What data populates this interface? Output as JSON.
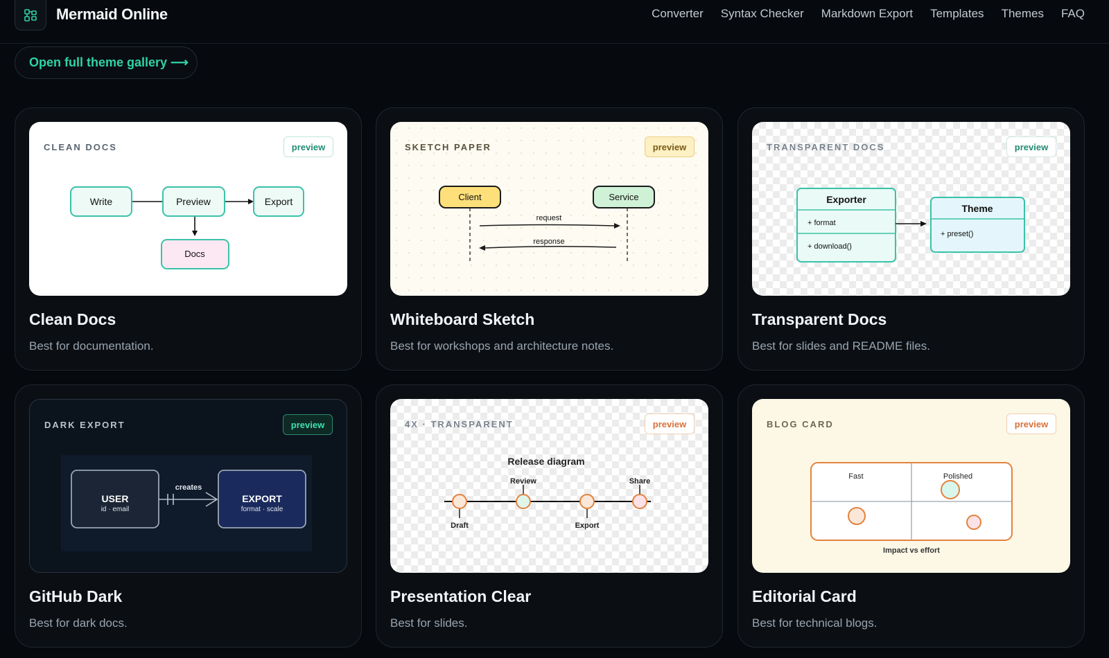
{
  "brand": {
    "name": "Mermaid Online",
    "logo_icon": "diagram-icon"
  },
  "nav": [
    "Converter",
    "Syntax Checker",
    "Markdown Export",
    "Templates",
    "Themes",
    "FAQ"
  ],
  "gallery_button": "Open full theme gallery ⟶",
  "colors": {
    "accent": "#2fd3a4",
    "background": "#06090d",
    "card": "#0b0f14"
  },
  "cards": [
    {
      "title": "Clean Docs",
      "desc": "Best for documentation.",
      "preview": {
        "label": "CLEAN DOCS",
        "badge": "preview",
        "nodes": [
          "Write",
          "Preview",
          "Export",
          "Docs"
        ]
      }
    },
    {
      "title": "Whiteboard Sketch",
      "desc": "Best for workshops and architecture notes.",
      "preview": {
        "label": "SKETCH PAPER",
        "badge": "preview",
        "actors": [
          "Client",
          "Service"
        ],
        "messages": [
          "request",
          "response"
        ]
      }
    },
    {
      "title": "Transparent Docs",
      "desc": "Best for slides and README files.",
      "preview": {
        "label": "TRANSPARENT DOCS",
        "badge": "preview",
        "class_a": {
          "name": "Exporter",
          "field": "+ format",
          "method": "+ download()"
        },
        "class_b": {
          "name": "Theme",
          "method": "+ preset()"
        }
      }
    },
    {
      "title": "GitHub Dark",
      "desc": "Best for dark docs.",
      "preview": {
        "label": "DARK EXPORT",
        "badge": "preview",
        "entity_a": {
          "name": "USER",
          "attrs": "id · email"
        },
        "relation": "creates",
        "entity_b": {
          "name": "EXPORT",
          "attrs": "format · scale"
        }
      }
    },
    {
      "title": "Presentation Clear",
      "desc": "Best for slides.",
      "preview": {
        "label": "4X · TRANSPARENT",
        "badge": "preview",
        "diagram_title": "Release diagram",
        "milestones": [
          "Draft",
          "Review",
          "Export",
          "Share"
        ]
      }
    },
    {
      "title": "Editorial Card",
      "desc": "Best for technical blogs.",
      "preview": {
        "label": "BLOG CARD",
        "badge": "preview",
        "quadrant_labels": [
          "Fast",
          "Polished"
        ],
        "caption": "Impact vs effort"
      }
    }
  ]
}
